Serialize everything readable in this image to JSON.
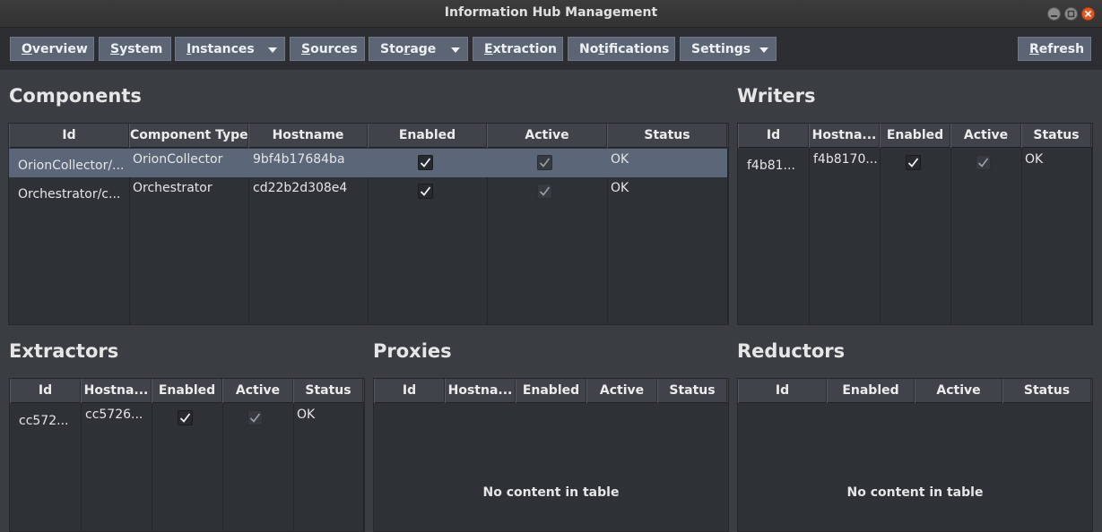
{
  "window": {
    "title": "Information Hub Management"
  },
  "menu": {
    "items": [
      {
        "label": "Overview",
        "underline": "O",
        "rest": "verview",
        "dropdown": false
      },
      {
        "label": "System",
        "underline": "S",
        "rest": "ystem",
        "dropdown": false
      },
      {
        "label": "Instances",
        "underline": "I",
        "rest": "nstances",
        "dropdown": true
      },
      {
        "label": "Sources",
        "underline": "S",
        "rest": "ources",
        "dropdown": false
      },
      {
        "label": "Storage",
        "underline": "",
        "rest": "",
        "dropdown": true
      },
      {
        "label": "Extraction",
        "underline": "E",
        "rest": "xtraction",
        "dropdown": false
      },
      {
        "label": "Notifications",
        "underline": "",
        "rest": "",
        "dropdown": false
      },
      {
        "label": "Settings",
        "underline": "",
        "rest": "",
        "dropdown": true
      }
    ],
    "storage": {
      "pre": "Sto",
      "u": "r",
      "post": "age"
    },
    "notifications": {
      "pre": "No",
      "u": "t",
      "post": "ifications"
    },
    "settings": {
      "pre": "Settings",
      "u": "",
      "post": ""
    },
    "refresh": {
      "u": "R",
      "rest": "efresh"
    }
  },
  "components": {
    "title": "Components",
    "headers": [
      "Id",
      "Component Type",
      "Hostname",
      "Enabled",
      "Active",
      "Status"
    ],
    "rows": [
      {
        "id": "OrionCollector/...",
        "type": "OrionCollector",
        "hostname": "9bf4b17684ba",
        "enabled": true,
        "active": true,
        "status": "OK",
        "selected": true
      },
      {
        "id": "Orchestrator/c...",
        "type": "Orchestrator",
        "hostname": "cd22b2d308e4",
        "enabled": true,
        "active": true,
        "status": "OK",
        "selected": false
      }
    ]
  },
  "writers": {
    "title": "Writers",
    "headers": [
      "Id",
      "Hostna...",
      "Enabled",
      "Active",
      "Status"
    ],
    "rows": [
      {
        "id": "f4b81...",
        "hostname": "f4b8170...",
        "enabled": true,
        "active": true,
        "status": "OK"
      }
    ]
  },
  "extractors": {
    "title": "Extractors",
    "headers": [
      "Id",
      "Hostna...",
      "Enabled",
      "Active",
      "Status"
    ],
    "rows": [
      {
        "id": "cc572...",
        "hostname": "cc5726...",
        "enabled": true,
        "active": true,
        "status": "OK"
      }
    ]
  },
  "proxies": {
    "title": "Proxies",
    "headers": [
      "Id",
      "Hostna...",
      "Enabled",
      "Active",
      "Status"
    ],
    "empty_text": "No content in table"
  },
  "reductors": {
    "title": "Reductors",
    "headers": [
      "Id",
      "Enabled",
      "Active",
      "Status"
    ],
    "empty_text": "No content in table"
  },
  "colors": {
    "menu_button": "#5b6573",
    "selected_row": "#5b6678",
    "close_button": "#e95420"
  }
}
